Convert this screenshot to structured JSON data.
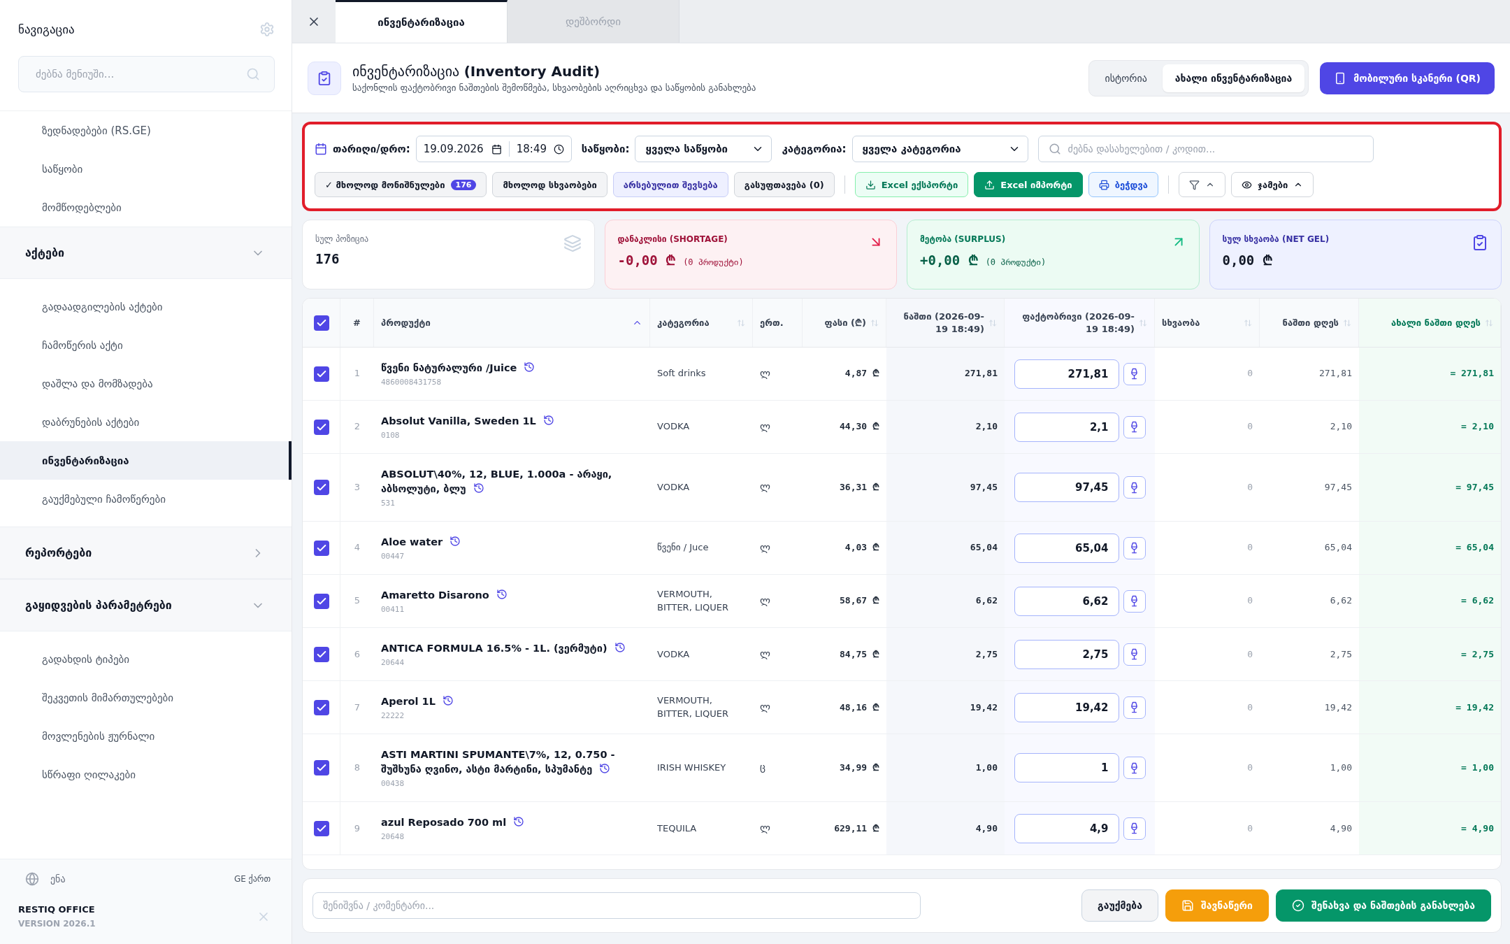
{
  "sidebar": {
    "title": "ნავიგაცია",
    "search_placeholder": "ძებნა მენიუში...",
    "nav": [
      {
        "kind": "link",
        "label": "ზედნადებები (RS.GE)",
        "selected": false
      },
      {
        "kind": "link",
        "label": "საწყობი",
        "selected": false
      },
      {
        "kind": "link",
        "label": "მომწოდებლები",
        "selected": false
      },
      {
        "kind": "group",
        "label": "აქტები",
        "expanded": true,
        "children": [
          {
            "label": "გადაადგილების აქტები",
            "selected": false
          },
          {
            "label": "ჩამოწერის აქტი",
            "selected": false
          },
          {
            "label": "დაშლა და მომზადება",
            "selected": false
          },
          {
            "label": "დაბრუნების აქტები",
            "selected": false
          },
          {
            "label": "ინვენტარიზაცია",
            "selected": true
          },
          {
            "label": "გაუქმებული ჩამოწერები",
            "selected": false
          }
        ]
      },
      {
        "kind": "group",
        "label": "რეპორტები",
        "expanded": false
      },
      {
        "kind": "group",
        "label": "გაყიდვების პარამეტრები",
        "expanded": true,
        "children": [
          {
            "label": "გადახდის ტიპები",
            "selected": false
          },
          {
            "label": "შეკვეთის მიმართულებები",
            "selected": false
          },
          {
            "label": "მოვლენების ჟურნალი",
            "selected": false
          },
          {
            "label": "სწრაფი ღილაკები",
            "selected": false
          }
        ]
      }
    ],
    "language_label": "ენა",
    "language_value": "GE ქართ",
    "brand": "RESTIQ OFFICE",
    "version": "VERSION 2026.1"
  },
  "tabs": [
    {
      "label": "ინვენტარიზაცია",
      "selected": true
    },
    {
      "label": "დეშბორდი",
      "selected": false
    }
  ],
  "header": {
    "title": "ინვენტარიზაცია **(Inventory Audit)**",
    "subtitle": "საქონლის ფაქტობრივი ნაშთების შემოწმება, სხვაობების აღრიცხვა და საწყობის განახლება",
    "views": [
      {
        "label": "ისტორია",
        "selected": false
      },
      {
        "label": "ახალი ინვენტარიზაცია",
        "selected": true
      }
    ],
    "scanner_button": "მობილური სკანერი (QR)"
  },
  "filters": {
    "date_label": "თარიღი/დრო:",
    "date": "19.09.2026",
    "time": "18:49",
    "warehouse_label": "საწყობი:",
    "warehouse": "ყველა საწყობი",
    "category_label": "კატეგორია:",
    "category": "ყველა კატეგორია",
    "search_placeholder": "ძებნა დასახელებით / კოდით...",
    "buttons": [
      {
        "kind": "chip",
        "label": "✓ მხოლოდ მონიშნულები",
        "badge": "176"
      },
      {
        "kind": "chip",
        "label": "მხოლოდ სხვაობები"
      },
      {
        "kind": "accent",
        "label": "არსებულით შევსება"
      },
      {
        "kind": "chip",
        "label": "გასუფთავება (0)"
      },
      {
        "kind": "export",
        "label": "Excel ექსპორტი"
      },
      {
        "kind": "import",
        "label": "Excel იმპორტი"
      },
      {
        "kind": "print",
        "label": "ბეჭდვა"
      },
      {
        "kind": "filter"
      },
      {
        "kind": "totals",
        "label": "ჯამები"
      }
    ]
  },
  "stats": [
    {
      "kind": "total",
      "label": "სულ პოზიცია",
      "value": "176"
    },
    {
      "kind": "shortage",
      "label": "დანაკლისი (SHORTAGE)",
      "value": "-0,00 ₾",
      "note": "(0 პროდუქტი)"
    },
    {
      "kind": "surplus",
      "label": "მეტობა (SURPLUS)",
      "value": "+0,00 ₾",
      "note": "(0 პროდუქტი)"
    },
    {
      "kind": "net",
      "label": "სულ სხვაობა (NET GEL)",
      "value": "0,00 ₾"
    }
  ],
  "table": {
    "all_checked": true,
    "columns": [
      {
        "label": "#"
      },
      {
        "label": "პროდუქტი",
        "sorted": true
      },
      {
        "label": "კატეგორია",
        "sorted": false
      },
      {
        "label": "ერთ."
      },
      {
        "label": "ფასი (₾)",
        "sorted": false
      },
      {
        "label": "ნაშთი (2026-09-19 18:49)",
        "sorted": false
      },
      {
        "label": "ფაქტობრივი (2026-09-19 18:49)",
        "sorted": false
      },
      {
        "label": "სხვაობა",
        "sorted": false
      },
      {
        "label": "ნაშთი დღეს",
        "sorted": false
      },
      {
        "label": "ახალი ნაშთი დღეს",
        "sorted": false
      }
    ],
    "rows": [
      {
        "checked": true,
        "number": "1",
        "name": "წვენი ნატურალური /Juice",
        "code": "4860008431758",
        "category": "Soft drinks",
        "unit": "ლ",
        "price": "4,87 ₾",
        "stock": "271,81",
        "actual": "271,81",
        "difference": "0",
        "stock_today": "271,81",
        "new_stock": "= 271,81"
      },
      {
        "checked": true,
        "number": "2",
        "name": "Absolut Vanilla, Sweden 1L",
        "code": "0108",
        "category": "VODKA",
        "unit": "ლ",
        "price": "44,30 ₾",
        "stock": "2,10",
        "actual": "2,1",
        "difference": "0",
        "stock_today": "2,10",
        "new_stock": "= 2,10"
      },
      {
        "checked": true,
        "number": "3",
        "name": "ABSOLUT\\40%, 12, BLUE, 1.000a - არაყი, აბსოლუტი, ბლუ",
        "code": "531",
        "category": "VODKA",
        "unit": "ლ",
        "price": "36,31 ₾",
        "stock": "97,45",
        "actual": "97,45",
        "difference": "0",
        "stock_today": "97,45",
        "new_stock": "= 97,45"
      },
      {
        "checked": true,
        "number": "4",
        "name": "Aloe water",
        "code": "00447",
        "category": "წვენი / Juce",
        "unit": "ლ",
        "price": "4,03 ₾",
        "stock": "65,04",
        "actual": "65,04",
        "difference": "0",
        "stock_today": "65,04",
        "new_stock": "= 65,04"
      },
      {
        "checked": true,
        "number": "5",
        "name": "Amaretto Disarono",
        "code": "00411",
        "category": "VERMOUTH, BITTER, LIQUER",
        "unit": "ლ",
        "price": "58,67 ₾",
        "stock": "6,62",
        "actual": "6,62",
        "difference": "0",
        "stock_today": "6,62",
        "new_stock": "= 6,62"
      },
      {
        "checked": true,
        "number": "6",
        "name": "ANTICA FORMULA 16.5% - 1L. (ვერმუტი)",
        "code": "20644",
        "category": "VODKA",
        "unit": "ლ",
        "price": "84,75 ₾",
        "stock": "2,75",
        "actual": "2,75",
        "difference": "0",
        "stock_today": "2,75",
        "new_stock": "= 2,75"
      },
      {
        "checked": true,
        "number": "7",
        "name": "Aperol 1L",
        "code": "22222",
        "category": "VERMOUTH, BITTER, LIQUER",
        "unit": "ლ",
        "price": "48,16 ₾",
        "stock": "19,42",
        "actual": "19,42",
        "difference": "0",
        "stock_today": "19,42",
        "new_stock": "= 19,42"
      },
      {
        "checked": true,
        "number": "8",
        "name": "ASTI MARTINI SPUMANTE\\7%, 12, 0.750 - შუშხუნა ღვინო, ასტი მარტინი, სპუმანტე",
        "code": "00438",
        "category": "IRISH WHISKEY",
        "unit": "ც",
        "price": "34,99 ₾",
        "stock": "1,00",
        "actual": "1",
        "difference": "0",
        "stock_today": "1,00",
        "new_stock": "= 1,00"
      },
      {
        "checked": true,
        "number": "9",
        "name": "azul Reposado 700 ml",
        "code": "20648",
        "category": "TEQUILA",
        "unit": "ლ",
        "price": "629,11 ₾",
        "stock": "4,90",
        "actual": "4,9",
        "difference": "0",
        "stock_today": "4,90",
        "new_stock": "= 4,90"
      }
    ]
  },
  "footer": {
    "comment_placeholder": "შენიშვნა / კომენტარი...",
    "cancel": "გაუქმება",
    "draft": "შავნაწერი",
    "save": "შენახვა და ნაშთების განახლება"
  }
}
